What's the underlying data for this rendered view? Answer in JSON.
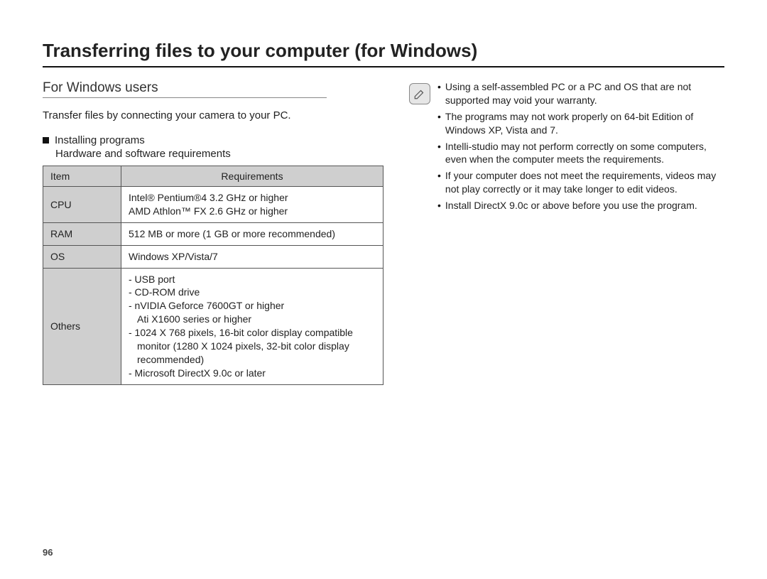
{
  "page_number": "96",
  "title": "Transferring files to your computer (for Windows)",
  "left": {
    "subtitle": "For Windows users",
    "intro": "Transfer files by connecting your camera to your PC.",
    "sub_heading_1": "Installing programs",
    "sub_heading_2": "Hardware and software requirements",
    "table": {
      "hdr_item": "Item",
      "hdr_req": "Requirements",
      "rows": [
        {
          "item": "CPU",
          "lines": [
            "Intel® Pentium®4 3.2 GHz or higher",
            "AMD Athlon™ FX 2.6 GHz or higher"
          ]
        },
        {
          "item": "RAM",
          "lines": [
            "512 MB or more (1 GB or more recommended)"
          ]
        },
        {
          "item": "OS",
          "lines": [
            "Windows XP/Vista/7"
          ]
        },
        {
          "item": "Others",
          "lines": [
            "- USB port",
            "- CD-ROM drive",
            "- nVIDIA Geforce 7600GT or higher",
            "  Ati X1600 series or higher",
            "- 1024 X 768 pixels, 16-bit color display compatible",
            "  monitor (1280 X 1024 pixels, 32-bit color display",
            "  recommended)",
            "- Microsoft DirectX 9.0c or later"
          ]
        }
      ]
    }
  },
  "right": {
    "notes": [
      "Using a self-assembled PC or a PC and OS that are not supported may void your warranty.",
      "The programs may not work properly on 64-bit Edition of Windows XP, Vista and 7.",
      "Intelli-studio may not perform correctly on some computers, even when the computer meets the requirements.",
      "If your computer does not meet the requirements, videos may not play correctly or it may take longer to edit videos.",
      "Install DirectX 9.0c or above before you use the program."
    ]
  }
}
